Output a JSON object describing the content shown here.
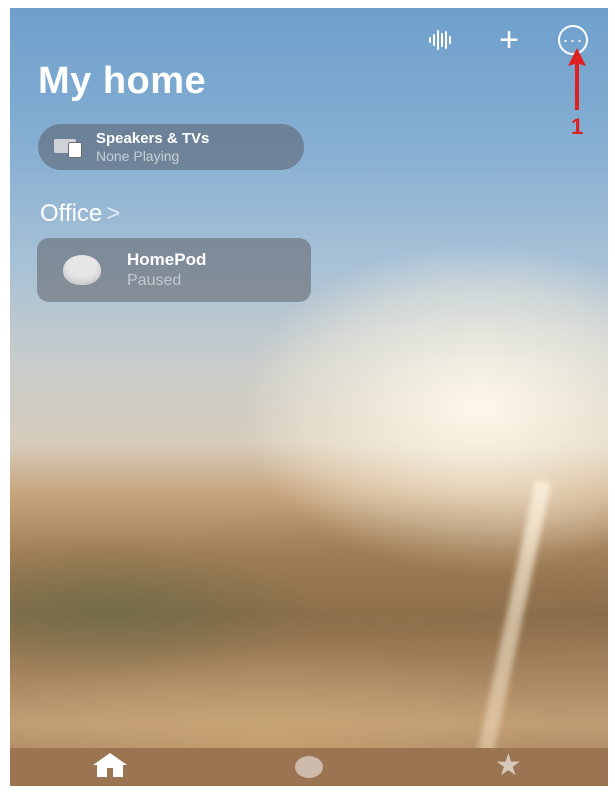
{
  "header": {
    "title": "My home",
    "icons": [
      "waveform-icon",
      "plus-icon",
      "more-icon"
    ]
  },
  "speakers": {
    "title": "Speakers & TVs",
    "subtitle": "None Playing"
  },
  "room": {
    "name": "Office",
    "chevron": ">"
  },
  "device": {
    "name": "HomePod",
    "status": "Paused"
  },
  "annotation": {
    "number": "1",
    "color": "#e02020"
  },
  "tabs": [
    {
      "icon": "home-icon"
    },
    {
      "icon": "rooms-icon"
    },
    {
      "icon": "star-icon"
    }
  ]
}
